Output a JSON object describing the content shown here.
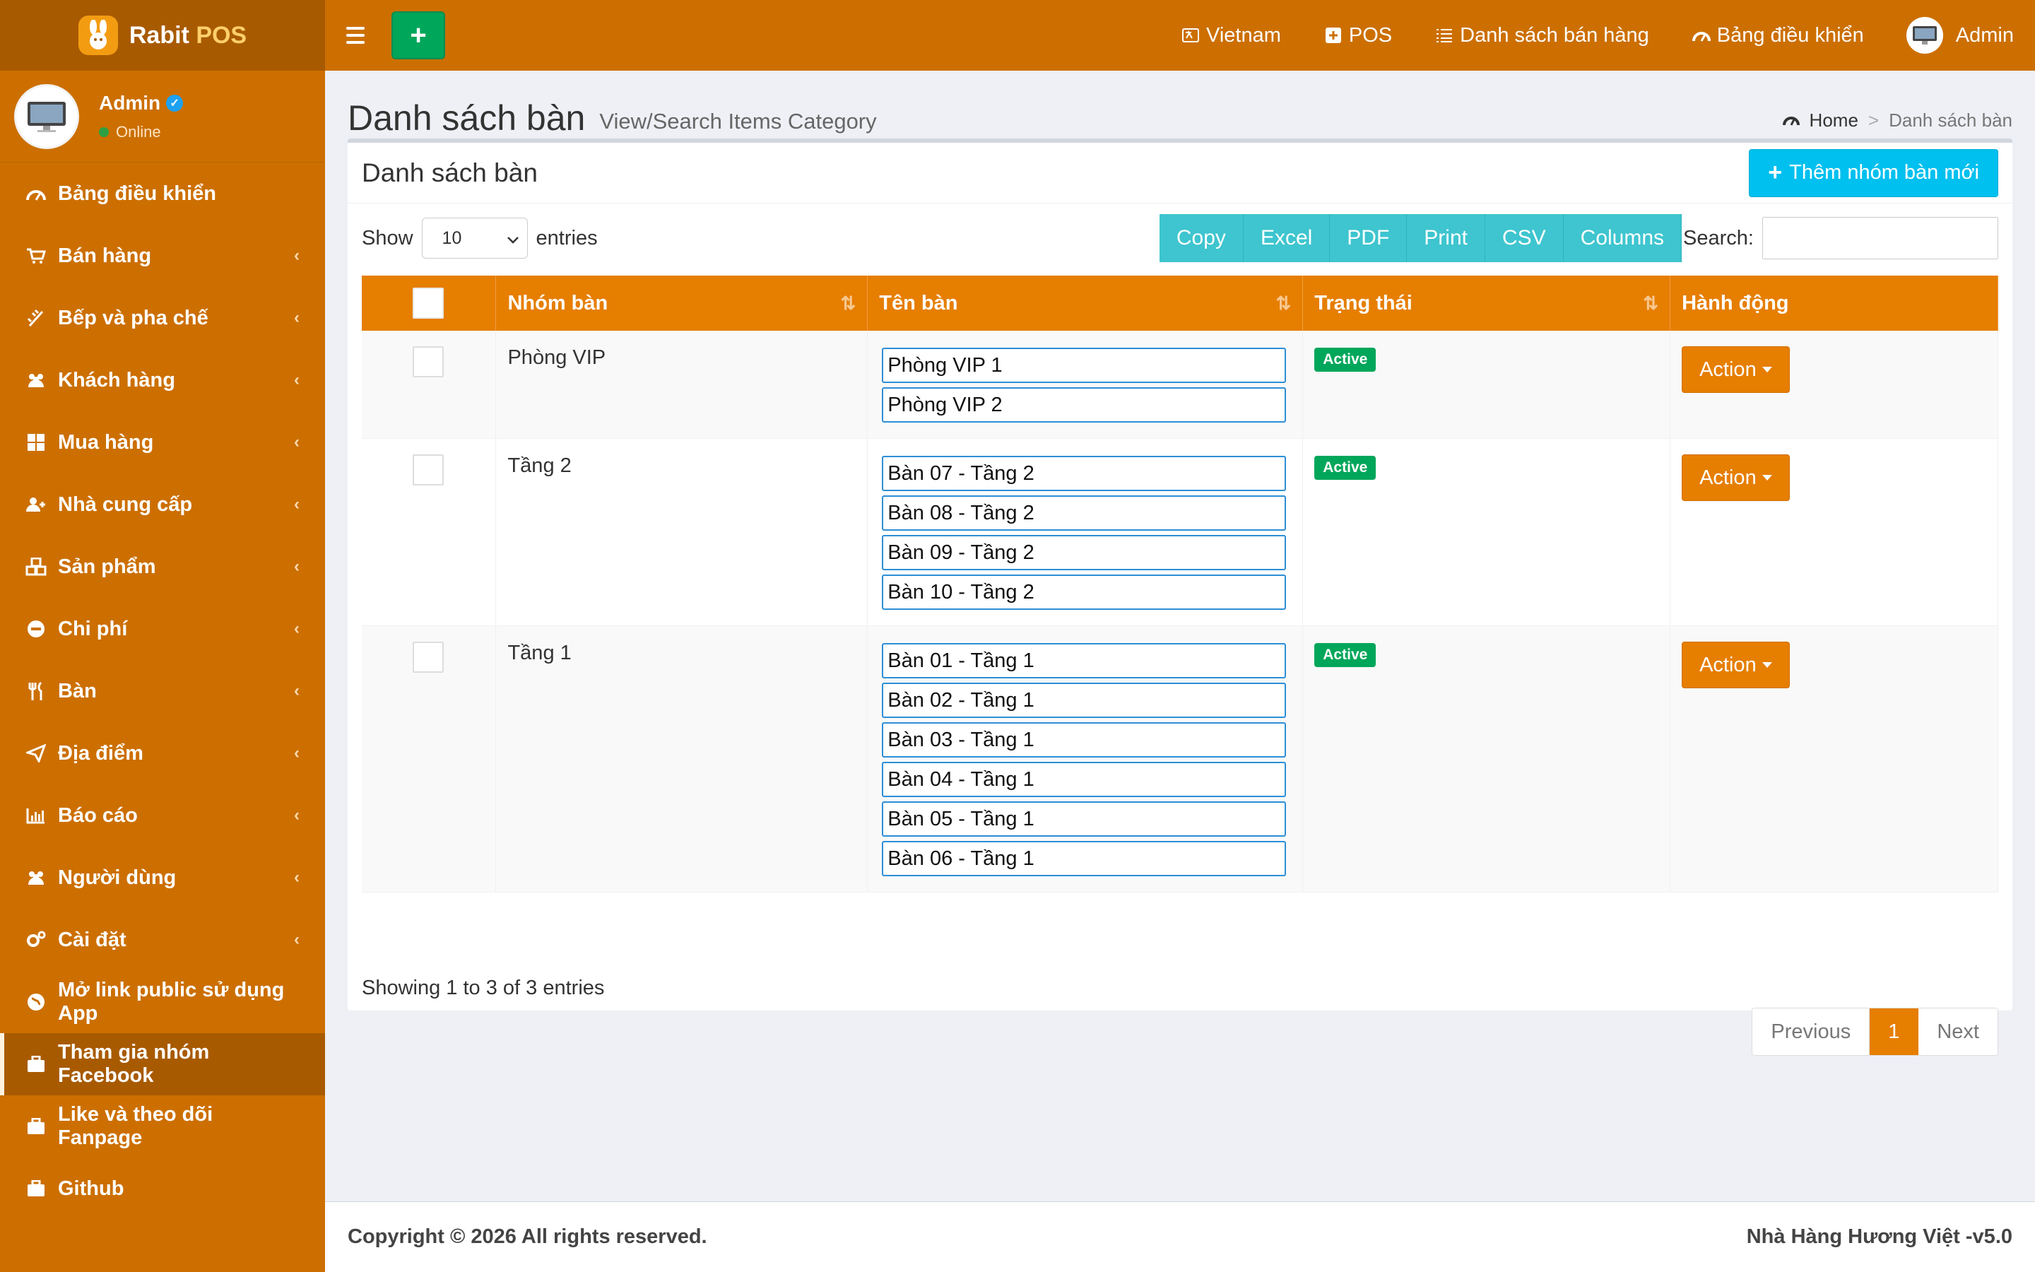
{
  "brand": {
    "name": "Rabit",
    "accent": "POS",
    "color": "#cc6f00"
  },
  "user": {
    "name": "Admin",
    "status": "Online"
  },
  "sidebar": {
    "items": [
      {
        "label": "Bảng điều khiển",
        "icon": "dashboard-icon",
        "has_children": false
      },
      {
        "label": "Bán hàng",
        "icon": "cart-icon",
        "has_children": true
      },
      {
        "label": "Bếp và pha chế",
        "icon": "kitchen-icon",
        "has_children": true
      },
      {
        "label": "Khách hàng",
        "icon": "users-icon",
        "has_children": true
      },
      {
        "label": "Mua hàng",
        "icon": "grid-icon",
        "has_children": true
      },
      {
        "label": "Nhà cung cấp",
        "icon": "user-plus-icon",
        "has_children": true
      },
      {
        "label": "Sản phẩm",
        "icon": "cubes-icon",
        "has_children": true
      },
      {
        "label": "Chi phí",
        "icon": "minus-circle-icon",
        "has_children": true
      },
      {
        "label": "Bàn",
        "icon": "cutlery-icon",
        "has_children": true
      },
      {
        "label": "Địa điểm",
        "icon": "send-icon",
        "has_children": true
      },
      {
        "label": "Báo cáo",
        "icon": "bar-chart-icon",
        "has_children": true
      },
      {
        "label": "Người dùng",
        "icon": "users-icon",
        "has_children": true
      },
      {
        "label": "Cài đặt",
        "icon": "cogs-icon",
        "has_children": true
      },
      {
        "label": "Mở link public sử dụng App",
        "icon": "globe-icon",
        "has_children": false
      },
      {
        "label": "Tham gia nhóm Facebook",
        "icon": "briefcase-icon",
        "has_children": false,
        "active": true
      },
      {
        "label": "Like và theo dõi Fanpage",
        "icon": "briefcase-icon",
        "has_children": false
      },
      {
        "label": "Github",
        "icon": "briefcase-icon",
        "has_children": false
      }
    ]
  },
  "topbar": {
    "links": [
      {
        "label": "Vietnam",
        "icon": "language-icon"
      },
      {
        "label": "POS",
        "icon": "plus-square-icon"
      },
      {
        "label": "Danh sách bán hàng",
        "icon": "list-icon"
      },
      {
        "label": "Bảng điều khiển",
        "icon": "dashboard-icon"
      }
    ],
    "user_label": "Admin"
  },
  "page": {
    "title": "Danh sách bàn",
    "subtitle": "View/Search Items Category",
    "breadcrumb_home": "Home",
    "breadcrumb_sep": ">",
    "breadcrumb_current": "Danh sách bàn"
  },
  "box": {
    "title": "Danh sách bàn",
    "add_button": "Thêm nhóm bàn mới"
  },
  "datatable": {
    "show_label": "Show",
    "entries_label": "entries",
    "page_size": "10",
    "buttons": [
      "Copy",
      "Excel",
      "PDF",
      "Print",
      "CSV",
      "Columns"
    ],
    "search_label": "Search:",
    "search_value": "",
    "columns": [
      "Nhóm bàn",
      "Tên bàn",
      "Trạng thái",
      "Hành động"
    ],
    "rows": [
      {
        "group": "Phòng VIP",
        "tables": [
          "Phòng VIP 1",
          "Phòng VIP 2"
        ],
        "status": "Active",
        "action": "Action"
      },
      {
        "group": "Tầng 2",
        "tables": [
          "Bàn 07 - Tầng 2",
          "Bàn 08 - Tầng 2",
          "Bàn 09 - Tầng 2",
          "Bàn 10 - Tầng 2"
        ],
        "status": "Active",
        "action": "Action"
      },
      {
        "group": "Tầng 1",
        "tables": [
          "Bàn 01 - Tầng 1",
          "Bàn 02 - Tầng 1",
          "Bàn 03 - Tầng 1",
          "Bàn 04 - Tầng 1",
          "Bàn 05 - Tầng 1",
          "Bàn 06 - Tầng 1"
        ],
        "status": "Active",
        "action": "Action"
      }
    ],
    "info": "Showing 1 to 3 of 3 entries",
    "pagination": {
      "previous": "Previous",
      "current": "1",
      "next": "Next"
    }
  },
  "footer": {
    "copyright": "Copyright © 2026 All rights reserved.",
    "version": "Nhà Hàng Hương Việt -v5.0"
  }
}
